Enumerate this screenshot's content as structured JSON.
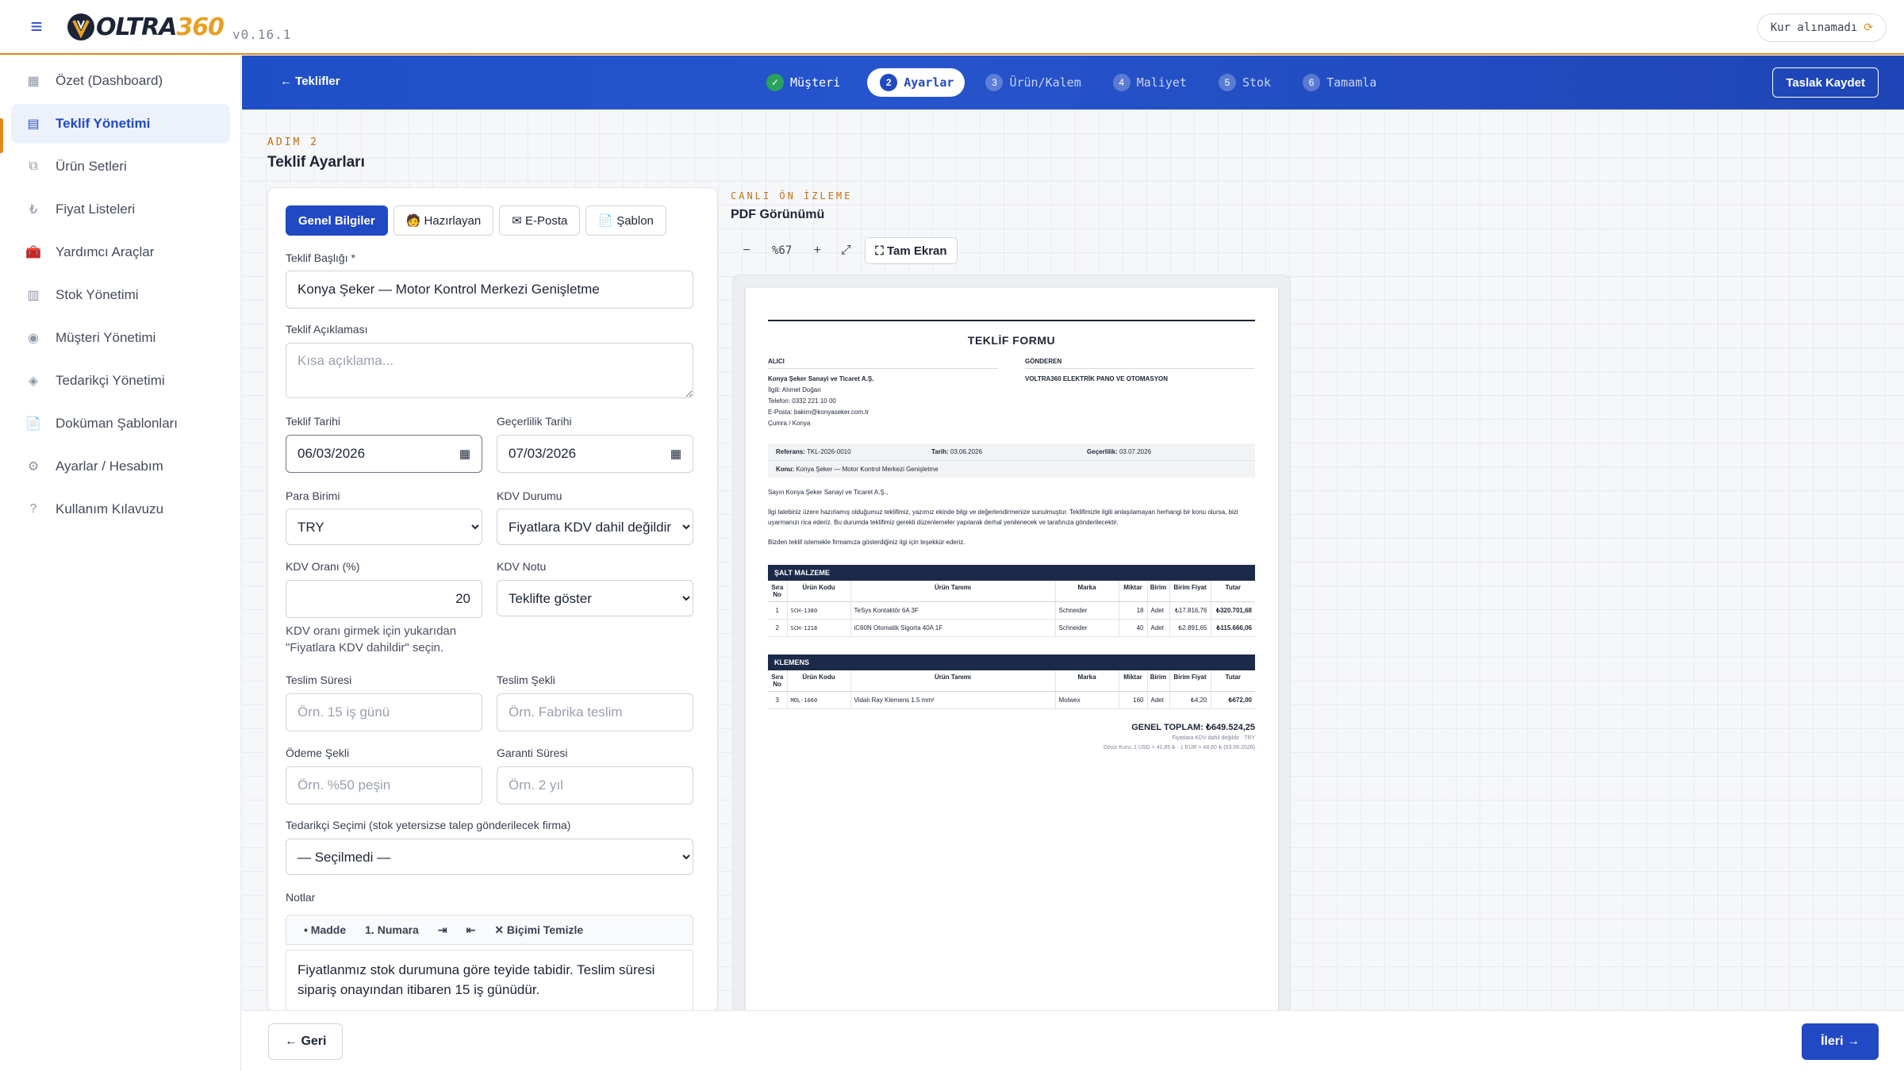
{
  "app": {
    "logo_text_dark": "OLTRA",
    "logo_text_accent": "360",
    "version": "v0.16.1",
    "rate_status": "Kur alınamadı",
    "colors": {
      "primary": "#2249c4",
      "accent": "#e08a1a",
      "success": "#2aa35a",
      "dark": "#1c2436"
    }
  },
  "sidebar": {
    "items": [
      {
        "label": "Özet (Dashboard)",
        "icon": "dashboard-icon",
        "glyph": "▦"
      },
      {
        "label": "Teklif Yönetimi",
        "icon": "document-list-icon",
        "glyph": "▤",
        "active": true
      },
      {
        "label": "Ürün Setleri",
        "icon": "layers-icon",
        "glyph": "⧉"
      },
      {
        "label": "Fiyat Listeleri",
        "icon": "lira-icon",
        "glyph": "₺"
      },
      {
        "label": "Yardımcı Araçlar",
        "icon": "toolbox-icon",
        "glyph": "🧰"
      },
      {
        "label": "Stok Yönetimi",
        "icon": "box-icon",
        "glyph": "▥"
      },
      {
        "label": "Müşteri Yönetimi",
        "icon": "user-icon",
        "glyph": "◉"
      },
      {
        "label": "Tedarikçi Yönetimi",
        "icon": "truck-icon",
        "glyph": "◈"
      },
      {
        "label": "Doküman Şablonları",
        "icon": "file-icon",
        "glyph": "📄"
      },
      {
        "label": "Ayarlar / Hesabım",
        "icon": "gear-icon",
        "glyph": "⚙"
      },
      {
        "label": "Kullanım Kılavuzu",
        "icon": "help-icon",
        "glyph": "?"
      }
    ]
  },
  "stepper": {
    "back_label": "← Teklifler",
    "steps": [
      {
        "num": "✓",
        "label": "Müşteri",
        "state": "done"
      },
      {
        "num": "2",
        "label": "Ayarlar",
        "state": "current"
      },
      {
        "num": "3",
        "label": "Ürün/Kalem",
        "state": "todo"
      },
      {
        "num": "4",
        "label": "Maliyet",
        "state": "todo"
      },
      {
        "num": "5",
        "label": "Stok",
        "state": "todo"
      },
      {
        "num": "6",
        "label": "Tamamla",
        "state": "todo"
      }
    ],
    "draft_label": "Taslak Kaydet"
  },
  "page": {
    "eyebrow": "ADIM 2",
    "title": "Teklif Ayarları"
  },
  "form": {
    "tabs": [
      {
        "label": "Genel Bilgiler",
        "active": true
      },
      {
        "label": "🧑 Hazırlayan"
      },
      {
        "label": "✉ E-Posta"
      },
      {
        "label": "📄 Şablon"
      }
    ],
    "title_label": "Teklif Başlığı *",
    "title_value": "Konya Şeker — Motor Kontrol Merkezi Genişletme",
    "desc_label": "Teklif Açıklaması",
    "desc_placeholder": "Kısa açıklama...",
    "date_label": "Teklif Tarihi",
    "date_value": "06/03/2026",
    "valid_label": "Geçerlilik Tarihi",
    "valid_value": "07/03/2026",
    "currency_label": "Para Birimi",
    "currency_value": "TRY",
    "vat_status_label": "KDV Durumu",
    "vat_status_value": "Fiyatlara KDV dahil değildir",
    "vat_rate_label": "KDV Oranı (%)",
    "vat_rate_value": "20",
    "vat_note_label": "KDV Notu",
    "vat_note_value": "Teklifte göster",
    "vat_hint": "KDV oranı girmek için yukarıdan \"Fiyatlara KDV dahildir\" seçin.",
    "delivery_time_label": "Teslim Süresi",
    "delivery_time_placeholder": "Örn. 15 iş günü",
    "delivery_type_label": "Teslim Şekli",
    "delivery_type_placeholder": "Örn. Fabrika teslim",
    "payment_label": "Ödeme Şekli",
    "payment_placeholder": "Örn. %50 peşin",
    "warranty_label": "Garanti Süresi",
    "warranty_placeholder": "Örn. 2 yıl",
    "supplier_label": "Tedarikçi Seçimi (stok yetersizse talep gönderilecek firma)",
    "supplier_value": "— Seçilmedi —",
    "notes_label": "Notlar",
    "notes_toolbar": [
      "• Madde",
      "1. Numara",
      "⇥",
      "⇤",
      "✕ Biçimi Temizle"
    ],
    "notes_value": "Fiyatlanmız stok durumuna göre teyide tabidir. Teslim süresi sipariş onayından itibaren 15 iş günüdür."
  },
  "preview": {
    "eyebrow": "CANLI ÖN İZLEME",
    "title": "PDF Görünümü",
    "zoom_out": "−",
    "zoom_level": "%67",
    "zoom_in": "+",
    "fit": "⤢",
    "fullscreen_label": "⛶ Tam Ekran",
    "pdf": {
      "title": "TEKLİF FORMU",
      "receiver_header": "ALICI",
      "receiver_name": "Konya Şeker Sanayi ve Ticaret A.Ş.",
      "receiver_lines": [
        "İlgili: Ahmet Doğan",
        "Telefon: 0332 221 10 00",
        "E-Posta: bakim@konyaseker.com.tr",
        "Çumra / Konya"
      ],
      "sender_header": "GÖNDEREN",
      "sender_name": "VOLTRA360 ELEKTRİK PANO VE OTOMASYON",
      "ref_label": "Referans:",
      "ref_value": "TKL-2026-0010",
      "date_label": "Tarih:",
      "date_value": "03.06.2026",
      "valid_label": "Geçerlilik:",
      "valid_value": "03.07.2026",
      "subject_label": "Konu:",
      "subject_value": "Konya Şeker — Motor Kontrol Merkezi Genişletme",
      "greeting": "Sayın Konya Şeker Sanayi ve Ticaret A.Ş.,",
      "paragraph1": "İlgi talebiniz üzere hazırlamış olduğumuz teklifimiz, yazımız ekinde bilgi ve değerlendirmenize sunulmuştur. Teklifimizle ilgili anlaşılamayan herhangi bir konu olursa, bizi uyarmanızı rica ederiz. Bu durumda teklifimiz gerekli düzenlemeler yapılarak derhal yenilenecek ve tarafınıza gönderilecektir.",
      "paragraph2": "Bizden teklif istemekle firmamıza gösterdiğiniz ilgi için teşekkür ederiz.",
      "columns": [
        "Sıra No",
        "Ürün Kodu",
        "Ürün Tanımı",
        "Marka",
        "Miktar",
        "Birim",
        "Birim Fiyat",
        "Tutar"
      ],
      "sections": [
        {
          "name": "ŞALT MALZEME",
          "rows": [
            [
              "1",
              "SCH-1380",
              "TeSys Kontaktör 6A 3F",
              "Schneider",
              "18",
              "Adet",
              "₺17.816,76",
              "₺320.701,68"
            ],
            [
              "2",
              "SCH-1218",
              "iC60N Otomatik Sigorta 40A 1F",
              "Schneider",
              "40",
              "Adet",
              "₺2.891,65",
              "₺115.666,06"
            ]
          ]
        },
        {
          "name": "KLEMENS",
          "rows": [
            [
              "3",
              "MOL-1660",
              "Vidalı Ray Klemens 1.5 mm²",
              "Molwex",
              "160",
              "Adet",
              "₺4,20",
              "₺672,00"
            ]
          ]
        }
      ],
      "total": "GENEL TOPLAM: ₺649.524,25",
      "vat_note": "Fiyatlara KDV dahil değildir · TRY",
      "fx_note": "Döviz Kuru: 1 USD = 41,85 ₺ · 1 EUR = 48,60 ₺ (03.06.2026)"
    }
  },
  "footer": {
    "back_label": "← Geri",
    "next_label": "İleri →"
  }
}
